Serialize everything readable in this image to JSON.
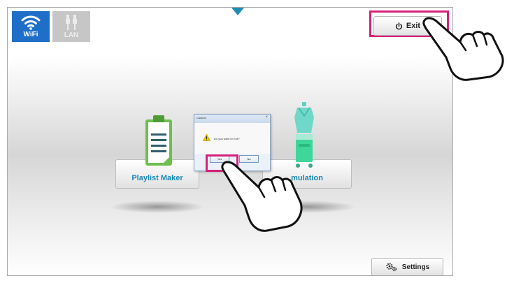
{
  "network": {
    "wifi": {
      "label": "WiFi",
      "active": true,
      "icon": "wifi-icon"
    },
    "lan": {
      "label": "LAN",
      "active": false,
      "icon": "lan-cable-icon"
    }
  },
  "header": {
    "exit_label": "Exit",
    "exit_icon": "power-icon"
  },
  "apps": [
    {
      "label": "Playlist Maker",
      "icon": "clipboard-icon"
    },
    {
      "label": "mulation",
      "icon": "mannequin-icon"
    }
  ],
  "dialog": {
    "title": "Caution",
    "message": "Do you want to Exit?",
    "yes_label": "Yes",
    "no_label": "No",
    "close_glyph": "×"
  },
  "footer": {
    "settings_label": "Settings",
    "settings_icon": "gears-icon"
  },
  "colors": {
    "highlight": "#d6217a",
    "accent": "#1a88b8",
    "wifi_bg": "#1f6fc8"
  }
}
